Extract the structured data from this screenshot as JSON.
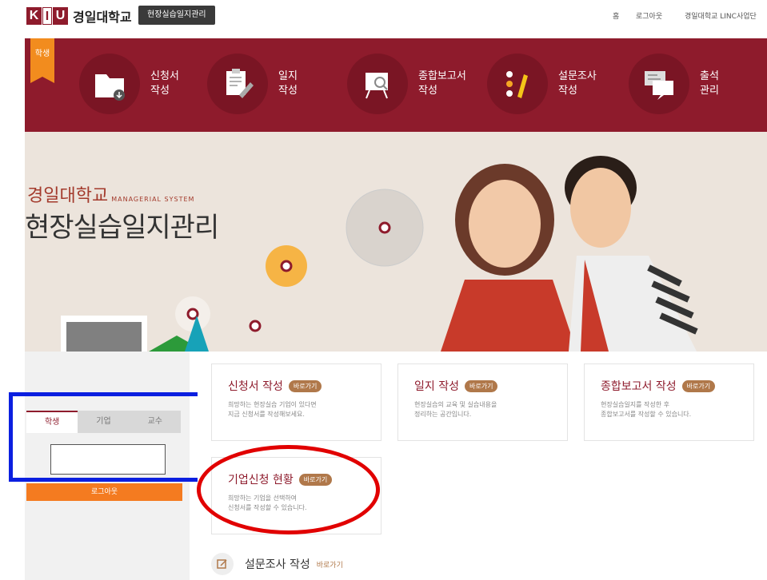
{
  "header": {
    "logo_text": "KIU",
    "university": "경일대학교",
    "system_button": "현장실습일지관리",
    "links": [
      "홈",
      "로그아웃",
      "경일대학교 LINC사업단"
    ]
  },
  "menu": {
    "role_tag": "학생",
    "items": [
      {
        "line1": "신청서",
        "line2": "작성",
        "icon": "folder-icon"
      },
      {
        "line1": "일지",
        "line2": "작성",
        "icon": "journal-edit-icon"
      },
      {
        "line1": "종합보고서",
        "line2": "작성",
        "icon": "presentation-board-icon"
      },
      {
        "line1": "설문조사",
        "line2": "작성",
        "icon": "survey-pencil-icon"
      },
      {
        "line1": "출석",
        "line2": "관리",
        "icon": "chat-bubbles-icon"
      }
    ]
  },
  "hero": {
    "subtitle": "경일대학교",
    "subtitle_en": "MANAGERIAL SYSTEM",
    "title": "현장실습일지관리"
  },
  "login": {
    "tabs": [
      "학생",
      "기업",
      "교수"
    ],
    "active_tab": "학생",
    "id_value": "",
    "logout_label": "로그아웃"
  },
  "cards": [
    {
      "title": "신청서 작성",
      "go": "바로가기",
      "desc1": "희망하는 현장실습 기업이 있다면",
      "desc2": "지금 신청서를 작성해보세요."
    },
    {
      "title": "일지 작성",
      "go": "바로가기",
      "desc1": "현장실습의 교육 및 실습내용을",
      "desc2": "정리하는 공간입니다."
    },
    {
      "title": "종합보고서 작성",
      "go": "바로가기",
      "desc1": "현장실습일지를 작성한 후",
      "desc2": "종합보고서를 작성할 수 있습니다."
    },
    {
      "title": "기업신청 현황",
      "go": "바로가기",
      "desc1": "희망하는 기업을 선택하여",
      "desc2": "신청서를 작성할 수 있습니다."
    }
  ],
  "survey": {
    "title": "설문조사 작성",
    "go": "바로가기"
  },
  "colors": {
    "brand": "#8e1b2c",
    "accent": "#f47b20",
    "highlight_box": "#0b1fe0",
    "highlight_oval": "#e10000"
  }
}
